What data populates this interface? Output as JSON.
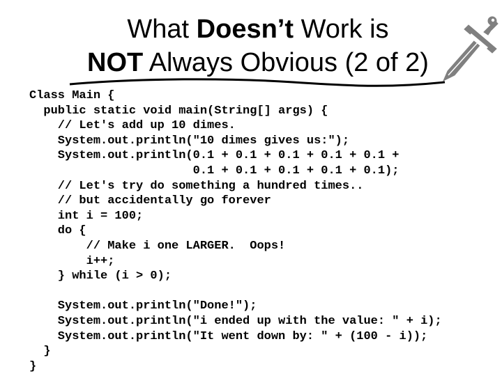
{
  "slide": {
    "title": {
      "line1": {
        "a": "What ",
        "b": "Doesn’t",
        "c": " Work is"
      },
      "line2": {
        "a": "NOT",
        "b": " Always Obvious (2 of 2)"
      }
    },
    "decoration_icon": "sword-icon",
    "accent_color": "#808080",
    "code_lines": [
      "Class Main {",
      "  public static void main(String[] args) {",
      "    // Let's add up 10 dimes.",
      "    System.out.println(\"10 dimes gives us:\");",
      "    System.out.println(0.1 + 0.1 + 0.1 + 0.1 + 0.1 +",
      "                       0.1 + 0.1 + 0.1 + 0.1 + 0.1);",
      "    // Let's try do something a hundred times..",
      "    // but accidentally go forever",
      "    int i = 100;",
      "    do {",
      "        // Make i one LARGER.  Oops!",
      "        i++;",
      "    } while (i > 0);",
      "",
      "    System.out.println(\"Done!\");",
      "    System.out.println(\"i ended up with the value: \" + i);",
      "    System.out.println(\"It went down by: \" + (100 - i));",
      "  }",
      "}"
    ]
  }
}
